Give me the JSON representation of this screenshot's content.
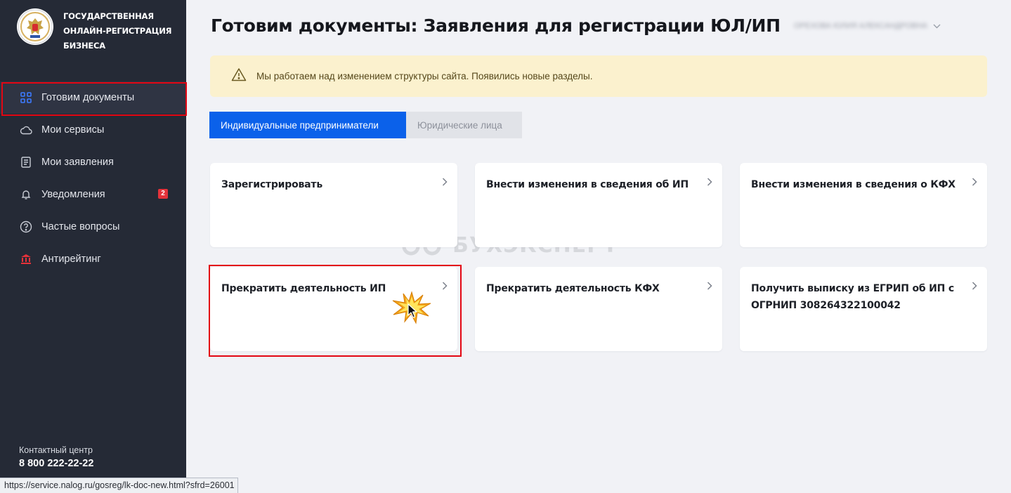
{
  "brand": {
    "lines": [
      "ГОСУДАРСТВЕННАЯ",
      "ОНЛАЙН-РЕГИСТРАЦИЯ",
      "БИЗНЕСА"
    ],
    "emblem_icon": "tax-service-emblem"
  },
  "sidebar": {
    "items": [
      {
        "label": "Готовим документы",
        "icon": "grid-icon",
        "active": true
      },
      {
        "label": "Мои сервисы",
        "icon": "cloud-icon"
      },
      {
        "label": "Мои заявления",
        "icon": "document-icon"
      },
      {
        "label": "Уведомления",
        "icon": "bell-icon",
        "badge": "2"
      },
      {
        "label": "Частые вопросы",
        "icon": "question-icon"
      },
      {
        "label": "Антирейтинг",
        "icon": "bank-icon"
      }
    ]
  },
  "contact": {
    "label": "Контактный центр",
    "phone": "8 800 222-22-22"
  },
  "header": {
    "title": "Готовим документы: Заявления для регистрации ЮЛ/ИП",
    "user_name": "ОРЕХОВА ЮЛИЯ АЛЕКСАНДРОВНА"
  },
  "notice": {
    "icon": "warning-icon",
    "text": "Мы работаем над изменением структуры сайта. Появились новые разделы."
  },
  "tabs": [
    {
      "label": "Индивидуальные предприниматели",
      "active": true
    },
    {
      "label": "Юридические лица",
      "active": false
    }
  ],
  "cards": [
    {
      "title": "Зарегистрировать"
    },
    {
      "title": "Внести изменения в сведения об ИП"
    },
    {
      "title": "Внести изменения в сведения о КФХ"
    },
    {
      "title": "Прекратить деятельность ИП",
      "highlighted": true
    },
    {
      "title": "Прекратить деятельность КФХ"
    },
    {
      "title": "Получить выписку из ЕГРИП об ИП с ОГРНИП 308264322100042"
    }
  ],
  "watermark": {
    "text": "БУХЭКСПЕРТ"
  },
  "status_bar": {
    "url": "https://service.nalog.ru/gosreg/lk-doc-new.html?sfrd=26001"
  },
  "colors": {
    "sidebar_bg": "#252a36",
    "accent_blue": "#0b61ea",
    "highlight_red": "#e30613",
    "notice_bg": "#fbf1ce",
    "page_bg": "#f1f2f6"
  }
}
